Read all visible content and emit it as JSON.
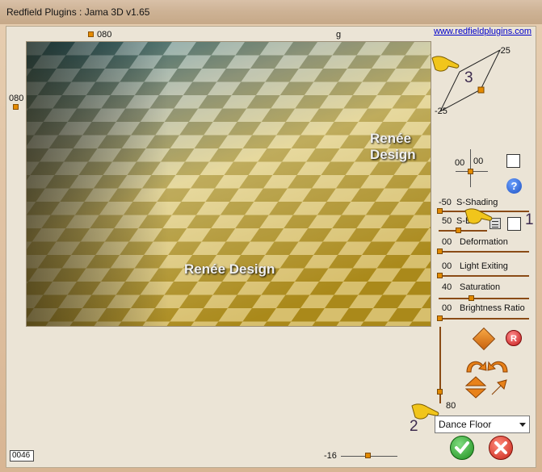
{
  "window": {
    "title": "Redfield Plugins : Jama 3D  v1.65"
  },
  "link": "www.redfieldplugins.com",
  "preview": {
    "top_marker_value": "080",
    "top_center_label": "g",
    "left_marker_value": "080",
    "watermark": "Renée Design"
  },
  "rotation": {
    "top_right": "-25",
    "bottom_left": "-25"
  },
  "position_pad": {
    "x": "00",
    "y": "00"
  },
  "controls": [
    {
      "value": "-50",
      "label": "S-Shading"
    },
    {
      "value": "50",
      "label": "S-Bal"
    },
    {
      "value": "00",
      "label": "Deformation"
    },
    {
      "value": "00",
      "label": "Light Exiting"
    },
    {
      "value": "40",
      "label": "Saturation"
    },
    {
      "value": "00",
      "label": "Brightness Ratio"
    }
  ],
  "vertical_slider_value": "80",
  "bottom_slider_value": "-16",
  "counter": "0046",
  "preset": {
    "selected": "Dance Floor"
  },
  "annotations": {
    "hand1": "1",
    "hand2": "2",
    "hand3": "3"
  },
  "colors": {
    "accent": "#e58b00",
    "ok": "#2fa82f",
    "cancel": "#d63a2a"
  }
}
